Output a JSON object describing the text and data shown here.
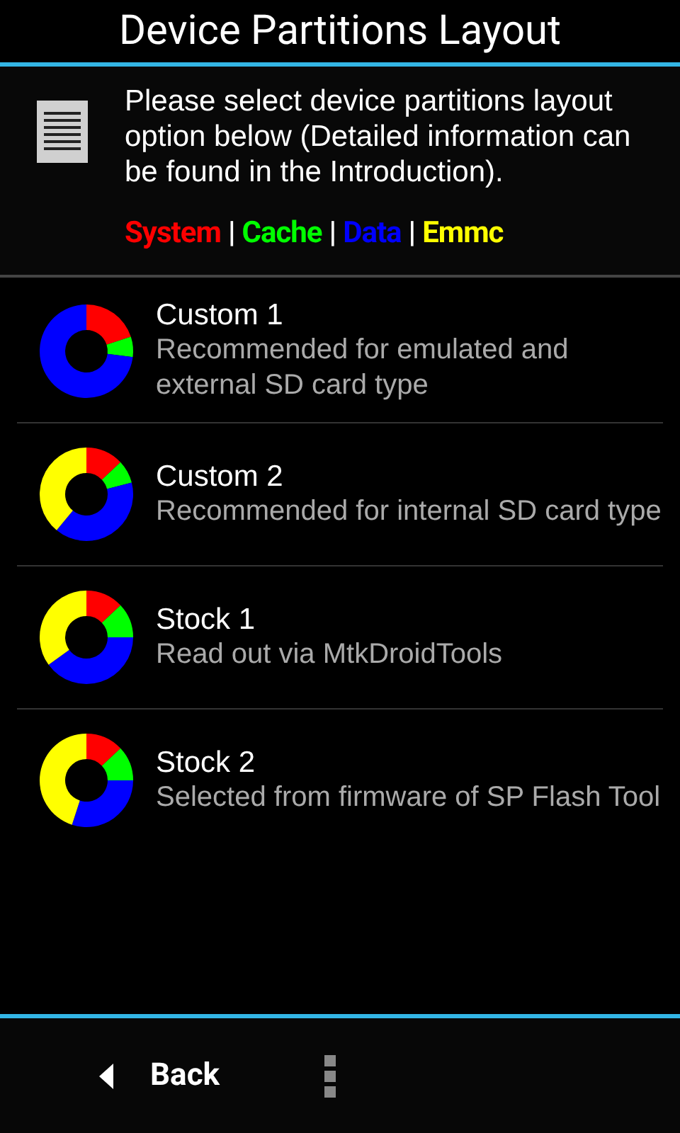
{
  "window": {
    "title": "Device Partitions Layout"
  },
  "intro": {
    "text": "Please select device partitions layout option below (Detailed information can be found in the Introduction)."
  },
  "legend": [
    {
      "label": "System",
      "color": "#ff0000"
    },
    {
      "label": "Cache",
      "color": "#00ff00"
    },
    {
      "label": "Data",
      "color": "#0000ff"
    },
    {
      "label": "Emmc",
      "color": "#ffff00"
    }
  ],
  "legend_separators": [
    "|",
    "|",
    "|"
  ],
  "options": [
    {
      "title": "Custom 1",
      "description": "Recommended for emulated and external SD card type"
    },
    {
      "title": "Custom 2",
      "description": "Recommended for internal SD card type"
    },
    {
      "title": "Stock 1",
      "description": "Read out via MtkDroidTools"
    },
    {
      "title": "Stock 2",
      "description": "Selected from firmware of SP Flash Tool"
    }
  ],
  "bottom_bar": {
    "back": "Back"
  }
}
